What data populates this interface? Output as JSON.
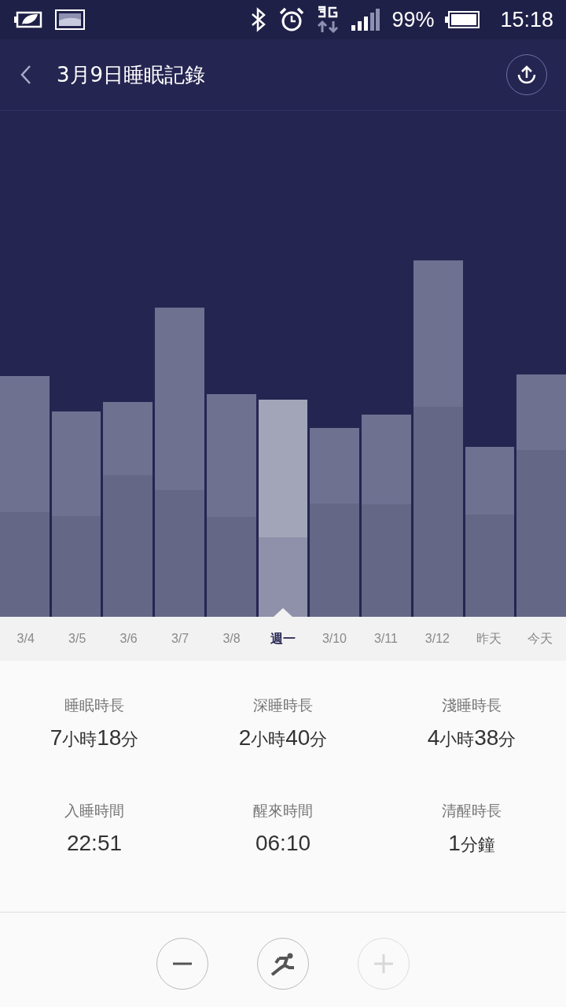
{
  "status_bar": {
    "battery": "99%",
    "time": "15:18"
  },
  "header": {
    "title": "3月9日睡眠記錄"
  },
  "days": [
    {
      "label": "3/4",
      "selected": false
    },
    {
      "label": "3/5",
      "selected": false
    },
    {
      "label": "3/6",
      "selected": false
    },
    {
      "label": "3/7",
      "selected": false
    },
    {
      "label": "3/8",
      "selected": false
    },
    {
      "label": "週一",
      "selected": true
    },
    {
      "label": "3/10",
      "selected": false
    },
    {
      "label": "3/11",
      "selected": false
    },
    {
      "label": "3/12",
      "selected": false
    },
    {
      "label": "昨天",
      "selected": false
    },
    {
      "label": "今天",
      "selected": false
    }
  ],
  "stats": [
    {
      "label": "睡眠時長",
      "parts": [
        {
          "n": "7",
          "u": "小時"
        },
        {
          "n": "18",
          "u": "分"
        }
      ]
    },
    {
      "label": "深睡時長",
      "parts": [
        {
          "n": "2",
          "u": "小時"
        },
        {
          "n": "40",
          "u": "分"
        }
      ]
    },
    {
      "label": "淺睡時長",
      "parts": [
        {
          "n": "4",
          "u": "小時"
        },
        {
          "n": "38",
          "u": "分"
        }
      ]
    },
    {
      "label": "入睡時間",
      "parts": [
        {
          "n": "22:51"
        }
      ]
    },
    {
      "label": "醒來時間",
      "parts": [
        {
          "n": "06:10"
        }
      ]
    },
    {
      "label": "清醒時長",
      "parts": [
        {
          "n": "1",
          "u": "分鐘"
        }
      ]
    }
  ],
  "controls": [
    {
      "kind": "minus",
      "disabled": false
    },
    {
      "kind": "run",
      "disabled": false
    },
    {
      "kind": "plus",
      "disabled": true
    }
  ]
}
